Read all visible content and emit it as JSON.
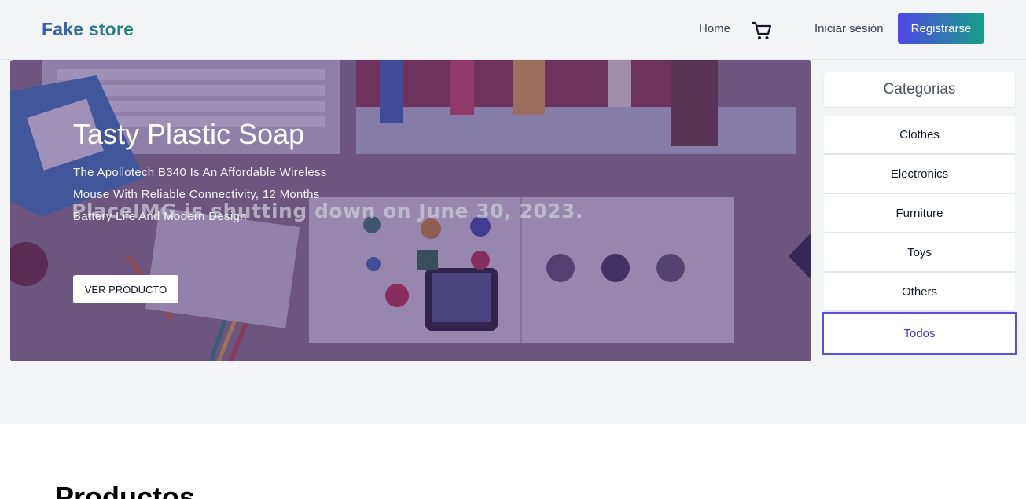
{
  "navbar": {
    "brand": "Fake store",
    "home_label": "Home",
    "cart_icon": "cart-icon",
    "login_label": "Iniciar sesión",
    "register_label": "Registrarse"
  },
  "hero": {
    "watermark": "PlaceIMG is shutting down on June 30, 2023.",
    "title": "Tasty Plastic Soap",
    "description": "The Apollotech B340 Is An Affordable Wireless Mouse With Reliable Connectivity, 12 Months Battery Life And Modern Design",
    "button_label": "VER PRODUCTO"
  },
  "categories": {
    "header": "Categorias",
    "items": [
      {
        "label": "Clothes"
      },
      {
        "label": "Electronics"
      },
      {
        "label": "Furniture"
      },
      {
        "label": "Toys"
      },
      {
        "label": "Others"
      },
      {
        "label": "Todos"
      }
    ],
    "active_index": 5
  },
  "products": {
    "title": "Productos"
  },
  "colors": {
    "accent": "#5b4fe0",
    "register_gradient_start": "#4f46e5",
    "register_gradient_end": "#16a085",
    "page_bg": "#f3f4f6"
  }
}
